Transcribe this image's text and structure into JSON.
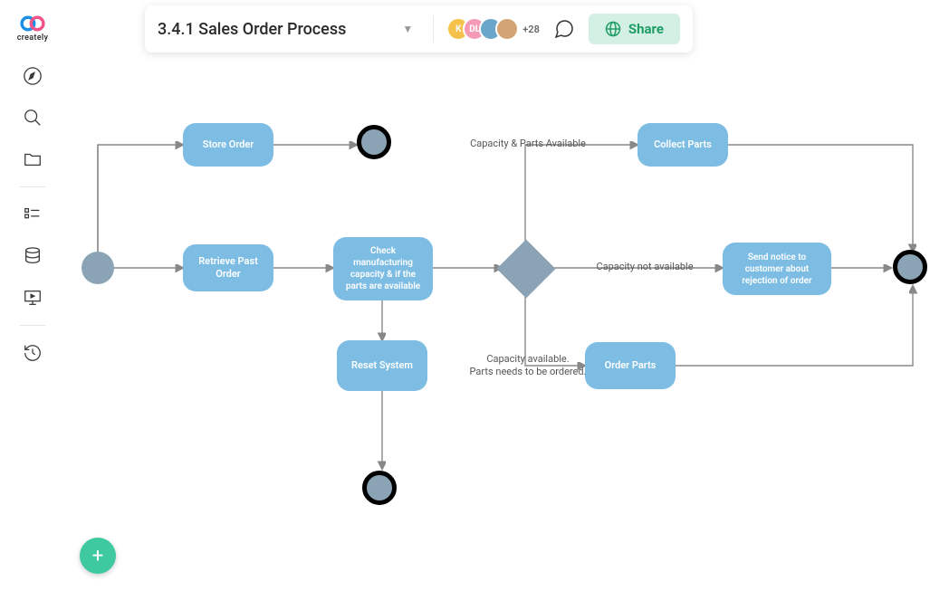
{
  "brand": {
    "name": "creately"
  },
  "header": {
    "title": "3.4.1 Sales Order Process",
    "avatars": [
      {
        "label": "K",
        "color": "#f4c24a"
      },
      {
        "label": "DL",
        "color": "#f49ab5"
      },
      {
        "label": "",
        "color": "#6aa6c9"
      },
      {
        "label": "",
        "color": "#d4a574"
      }
    ],
    "more_count": "+28",
    "share_label": "Share"
  },
  "diagram": {
    "nodes": {
      "store_order": "Store Order",
      "retrieve": "Retrieve Past Order",
      "check": "Check manufacturing capacity & if the parts are available",
      "reset": "Reset System",
      "collect": "Collect Parts",
      "notice": "Send notice to customer about rejection of order",
      "order_parts": "Order Parts"
    },
    "labels": {
      "cap_parts": "Capacity & Parts Available",
      "cap_not": "Capacity not available",
      "cap_avail": "Capacity available.\nParts needs to be ordered."
    }
  }
}
